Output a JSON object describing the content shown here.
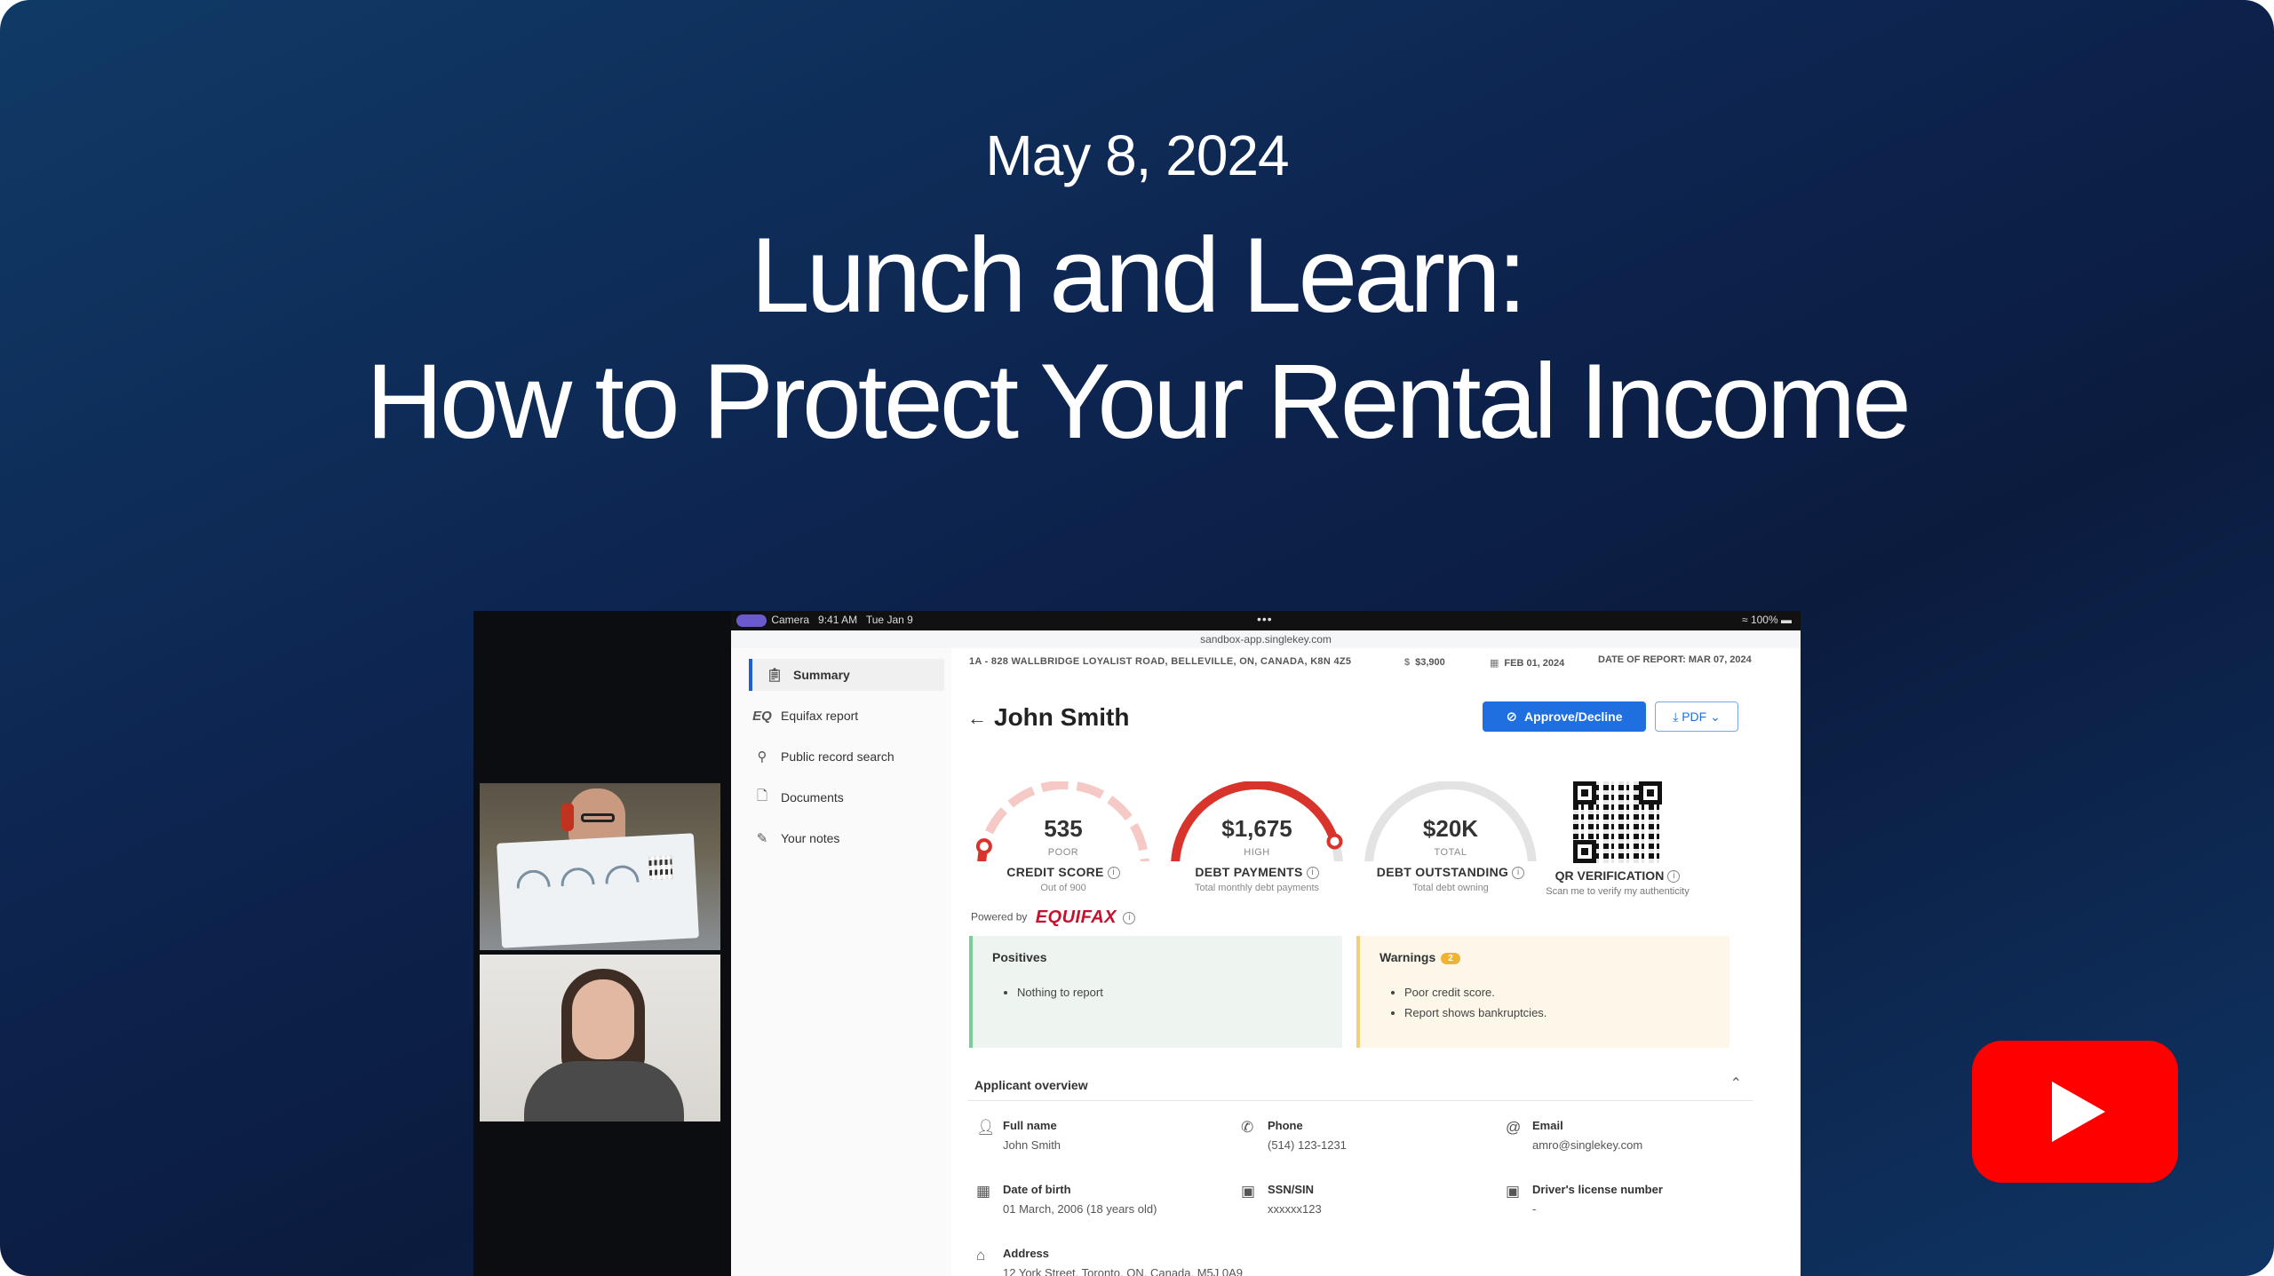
{
  "header": {
    "date": "May 8, 2024",
    "title_line1": "Lunch and Learn:",
    "title_line2": "How to Protect Your Rental Income"
  },
  "ipad_status": {
    "camera": "Camera",
    "time": "9:41 AM",
    "day": "Tue Jan 9",
    "battery": "100%",
    "url": "sandbox-app.singlekey.com"
  },
  "sidebar": {
    "items": [
      {
        "label": "Summary",
        "icon": "clipboard-icon"
      },
      {
        "label": "Equifax report",
        "icon": "eq-icon"
      },
      {
        "label": "Public record search",
        "icon": "person-search-icon"
      },
      {
        "label": "Documents",
        "icon": "document-icon"
      },
      {
        "label": "Your notes",
        "icon": "pencil-icon"
      }
    ]
  },
  "report": {
    "address": "1A - 828 WALLBRIDGE LOYALIST ROAD, BELLEVILLE, ON, CANADA, K8N 4Z5",
    "rent": "$3,900",
    "move_in": "FEB 01, 2024",
    "date_of_report": "DATE OF REPORT: MAR 07, 2024",
    "applicant_name": "John Smith",
    "approve_button": "Approve/Decline",
    "pdf_button": "PDF",
    "gauges": [
      {
        "value": "535",
        "sub": "POOR",
        "label": "CREDIT SCORE",
        "desc": "Out of 900",
        "fraction": 0.08,
        "color": "#d9342b"
      },
      {
        "value": "$1,675",
        "sub": "HIGH",
        "label": "DEBT PAYMENTS",
        "desc": "Total monthly debt payments",
        "fraction": 0.9,
        "color": "#d9342b"
      },
      {
        "value": "$20K",
        "sub": "TOTAL",
        "label": "DEBT OUTSTANDING",
        "desc": "Total debt owning",
        "fraction": 0,
        "color": "#d9342b"
      }
    ],
    "qr_label": "QR VERIFICATION",
    "qr_desc": "Scan me to verify my authenticity",
    "powered_by": "Powered by",
    "equifax_logo": "EQUIFAX",
    "equifax_short": "EQ",
    "positives_title": "Positives",
    "positives": [
      "Nothing to report"
    ],
    "warnings_title": "Warnings",
    "warnings_count": "2",
    "warnings": [
      "Poor credit score.",
      "Report shows bankruptcies."
    ],
    "overview_title": "Applicant overview",
    "fields": {
      "full_name": {
        "label": "Full name",
        "value": "John Smith"
      },
      "phone": {
        "label": "Phone",
        "value": "(514) 123-1231"
      },
      "email": {
        "label": "Email",
        "value": "amro@singlekey.com"
      },
      "dob": {
        "label": "Date of birth",
        "value": "01 March, 2006 (18 years old)"
      },
      "ssn": {
        "label": "SSN/SIN",
        "value": "xxxxxx123"
      },
      "license": {
        "label": "Driver's license number",
        "value": "-"
      },
      "address": {
        "label": "Address",
        "value": "12 York Street, Toronto, ON, Canada, M5J 0A9"
      }
    }
  },
  "colors": {
    "accent": "#1f6fe0",
    "danger": "#d9342b",
    "youtube": "#ff0000"
  }
}
